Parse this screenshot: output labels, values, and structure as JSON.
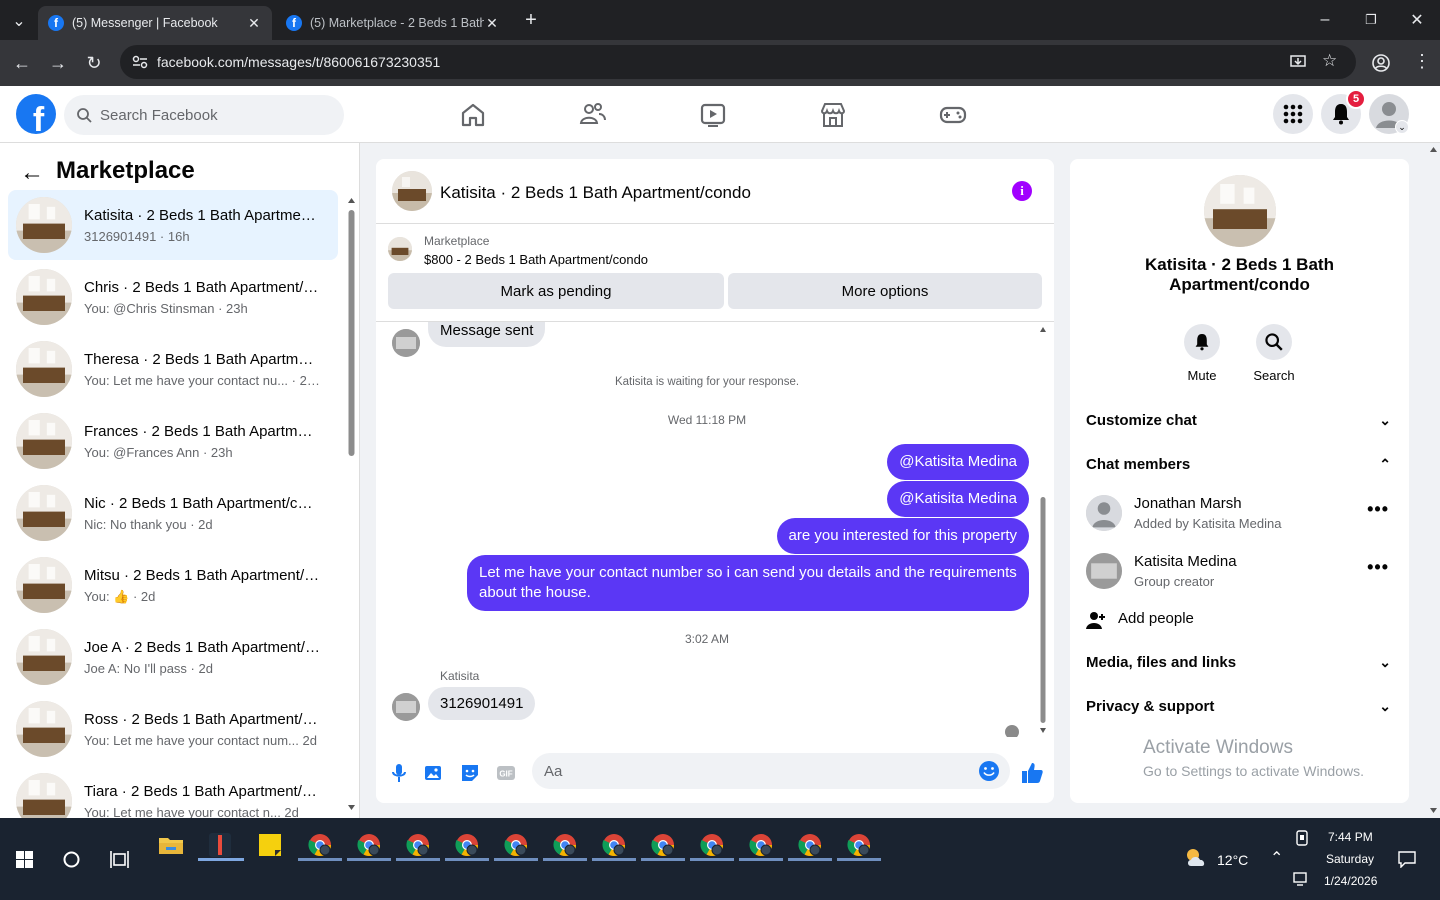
{
  "browser": {
    "tabs": [
      {
        "title": "(5) Messenger | Facebook",
        "active": true
      },
      {
        "title": "(5) Marketplace - 2 Beds 1 Bath",
        "active": false
      }
    ],
    "url": "facebook.com/messages/t/860061673230351"
  },
  "header": {
    "search_placeholder": "Search Facebook",
    "notification_count": "5",
    "nav_icons": [
      "home-icon",
      "friends-icon",
      "video-icon",
      "marketplace-icon",
      "gaming-icon"
    ],
    "accent": "#1877f2"
  },
  "sidebar": {
    "title": "Marketplace",
    "conversations": [
      {
        "name": "Katisita · 2 Beds 1 Bath Apartment/condo",
        "preview": "3126901491 · 16h",
        "selected": true
      },
      {
        "name": "Chris · 2 Beds 1 Bath Apartment/condo",
        "preview": "You: @Chris Stinsman · 23h"
      },
      {
        "name": "Theresa · 2 Beds 1 Bath Apartment/condo",
        "preview": "You: Let me have your contact nu... · 23h"
      },
      {
        "name": "Frances · 2 Beds 1 Bath Apartment/condo",
        "preview": "You: @Frances Ann · 23h"
      },
      {
        "name": "Nic · 2 Beds 1 Bath Apartment/condo",
        "preview": "Nic: No thank you · 2d"
      },
      {
        "name": "Mitsu · 2 Beds 1 Bath Apartment/condo",
        "preview": "You: 👍 · 2d"
      },
      {
        "name": "Joe A · 2 Beds 1 Bath Apartment/condo",
        "preview": "Joe A: No I'll pass · 2d"
      },
      {
        "name": "Ross · 2 Beds 1 Bath Apartment/condo",
        "preview": "You: Let me have your contact num... 2d"
      },
      {
        "name": "Tiara · 2 Beds 1 Bath Apartment/condo",
        "preview": "You: Let me have your contact n... 2d"
      }
    ]
  },
  "chat": {
    "title": "Katisita · 2 Beds 1 Bath Apartment/condo",
    "marketplace_label": "Marketplace",
    "listing": "$800 - 2 Beds 1 Bath Apartment/condo",
    "mark_pending": "Mark as pending",
    "more_options": "More options",
    "messages": {
      "sent_notice": "Message sent",
      "waiting": "Katisita is waiting for your response.",
      "time1": "Wed 11:18 PM",
      "out1": "@Katisita Medina",
      "out2": "@Katisita Medina",
      "out3": "are you interested for this property",
      "out4": "Let me have your contact number so i can send you details and the requirements about the house.",
      "time2": "3:02 AM",
      "sender": "Katisita",
      "in1": "3126901491"
    },
    "composer_placeholder": "Aa",
    "bubble_color": "#5b37f5"
  },
  "details": {
    "name": "Katisita · 2 Beds 1 Bath Apartment/condo",
    "mute": "Mute",
    "search": "Search",
    "customize": "Customize chat",
    "members_heading": "Chat members",
    "members": [
      {
        "name": "Jonathan Marsh",
        "role": "Added by Katisita Medina"
      },
      {
        "name": "Katisita Medina",
        "role": "Group creator"
      }
    ],
    "add_people": "Add people",
    "media": "Media, files and links",
    "privacy": "Privacy & support",
    "activate_title": "Activate Windows",
    "activate_sub": "Go to Settings to activate Windows."
  },
  "taskbar": {
    "weather": "12°C",
    "time": "7:44 PM",
    "day": "Saturday",
    "date": "1/24/2026"
  }
}
